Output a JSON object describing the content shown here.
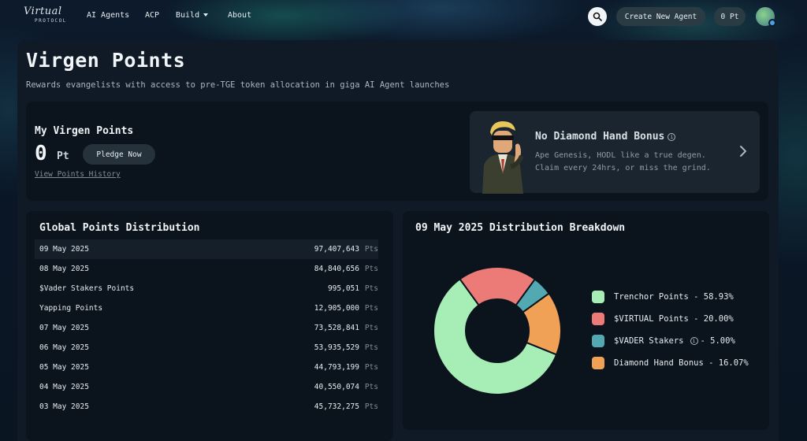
{
  "nav": {
    "logo_script": "Virtual",
    "logo_sub": "PROTOCOL",
    "links": [
      "AI Agents",
      "ACP",
      "Build",
      "About"
    ],
    "create_label": "Create New Agent",
    "points_label": "0 Pt"
  },
  "page": {
    "title": "Virgen Points",
    "subtitle": "Rewards evangelists with access to pre-TGE token allocation in giga AI Agent launches"
  },
  "my_points": {
    "title": "My Virgen Points",
    "value": "0",
    "unit": "Pt",
    "pledge_label": "Pledge Now",
    "history_label": "View Points History"
  },
  "bonus": {
    "title": "No Diamond Hand Bonus",
    "line1": "Ape Genesis, HODL like a true degen.",
    "line2": "Claim every 24hrs, or miss the grind."
  },
  "global": {
    "title": "Global Points Distribution",
    "unit": "Pts",
    "rows": [
      {
        "label": "09 May 2025",
        "value": "97,407,643"
      },
      {
        "label": "08 May 2025",
        "value": "84,840,656"
      },
      {
        "label": "$Vader Stakers Points",
        "value": "995,051"
      },
      {
        "label": "Yapping Points",
        "value": "12,905,000"
      },
      {
        "label": "07 May 2025",
        "value": "73,528,841"
      },
      {
        "label": "06 May 2025",
        "value": "53,935,529"
      },
      {
        "label": "05 May 2025",
        "value": "44,793,199"
      },
      {
        "label": "04 May 2025",
        "value": "40,550,074"
      },
      {
        "label": "03 May 2025",
        "value": "45,732,275"
      }
    ]
  },
  "breakdown": {
    "title": "09 May 2025 Distribution Breakdown",
    "legend": [
      {
        "label": "Trenchor Points - 58.93%",
        "color": "#a6edb6"
      },
      {
        "label": "$VIRTUAL Points - 20.00%",
        "color": "#ec7a76"
      },
      {
        "label": "$VADER Stakers",
        "suffix": " - 5.00%",
        "color": "#52a9b1",
        "info": true
      },
      {
        "label": "Diamond Hand Bonus - 16.07%",
        "color": "#f0a155"
      }
    ]
  },
  "chart_data": {
    "type": "pie",
    "categories": [
      "Trenchor Points",
      "$VIRTUAL Points",
      "$VADER Stakers",
      "Diamond Hand Bonus"
    ],
    "values": [
      58.93,
      20.0,
      5.0,
      16.07
    ],
    "colors": [
      "#a6edb6",
      "#ec7a76",
      "#52a9b1",
      "#f0a155"
    ],
    "donut": true
  }
}
